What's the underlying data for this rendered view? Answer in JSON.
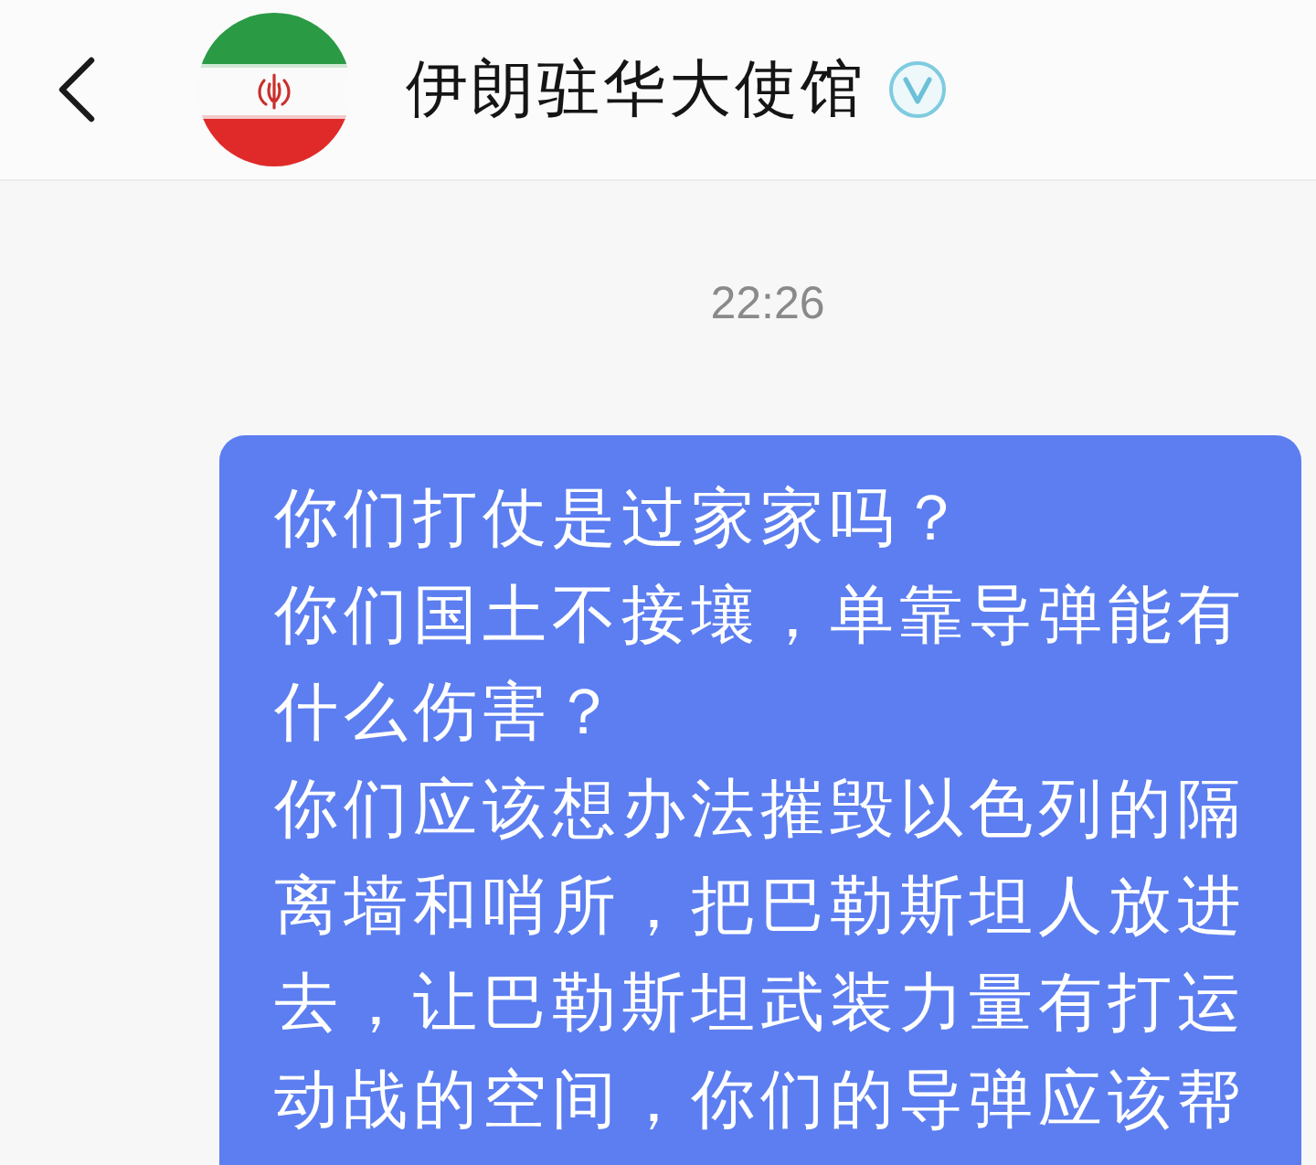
{
  "header": {
    "title": "伊朗驻华大使馆",
    "verified": true
  },
  "messages": [
    {
      "kind": "timestamp",
      "text": "22:26"
    },
    {
      "kind": "message",
      "outgoing": true,
      "paragraphs": [
        "你们打仗是过家家吗？",
        "你们国土不接壤，单靠导弹能有什么伤害？",
        "你们应该想办法摧毁以色列的隔离墙和哨所，把巴勒斯坦人放进去，让巴勒斯坦武装力量有打运动战的空间，你们的导弹应该帮"
      ]
    }
  ]
}
